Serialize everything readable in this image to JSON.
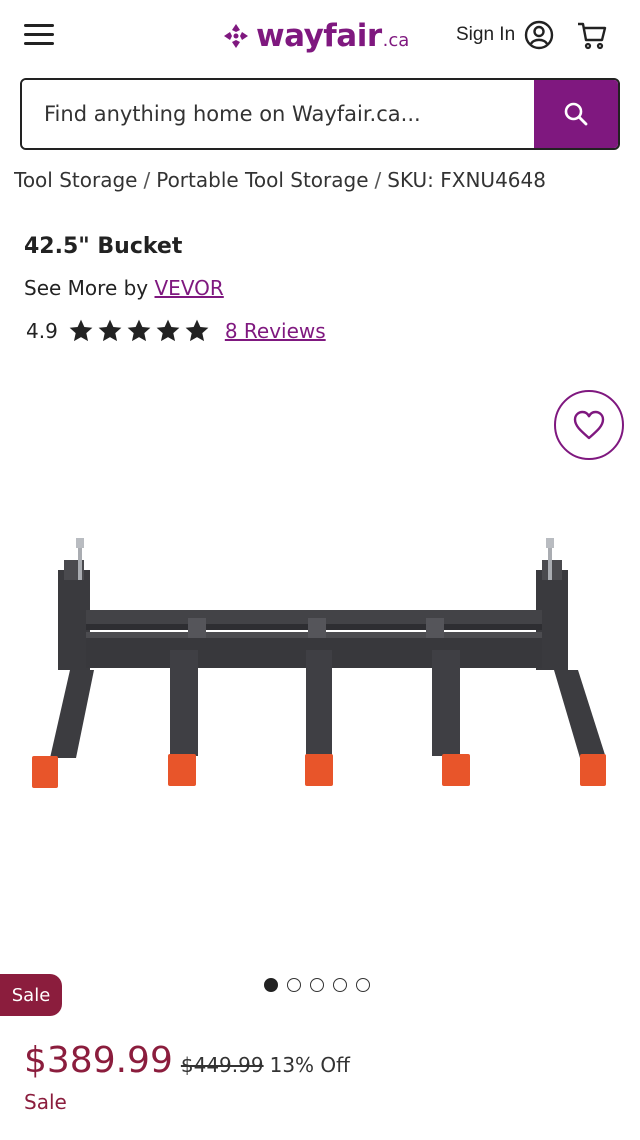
{
  "header": {
    "logo_text": "wayfair",
    "logo_tld": ".ca",
    "signin_label": "Sign In",
    "brand_color": "#7f187f"
  },
  "search": {
    "placeholder": "Find anything home on Wayfair.ca...",
    "button_icon": "search-icon"
  },
  "breadcrumb": {
    "items": [
      "Tool Storage",
      "Portable Tool Storage",
      "SKU: FXNU4648"
    ]
  },
  "product": {
    "title": "42.5\" Bucket",
    "see_more_prefix": "See More by",
    "brand": "VEVOR",
    "rating": "4.9",
    "stars": 5,
    "reviews_label": "8 Reviews"
  },
  "gallery": {
    "image_count": 5,
    "active_index": 0
  },
  "pricing": {
    "badge": "Sale",
    "price": "$389.99",
    "original_price": "$449.99",
    "discount": "13% Off",
    "sale_label": "Sale",
    "sale_color": "#8b1d3d"
  }
}
